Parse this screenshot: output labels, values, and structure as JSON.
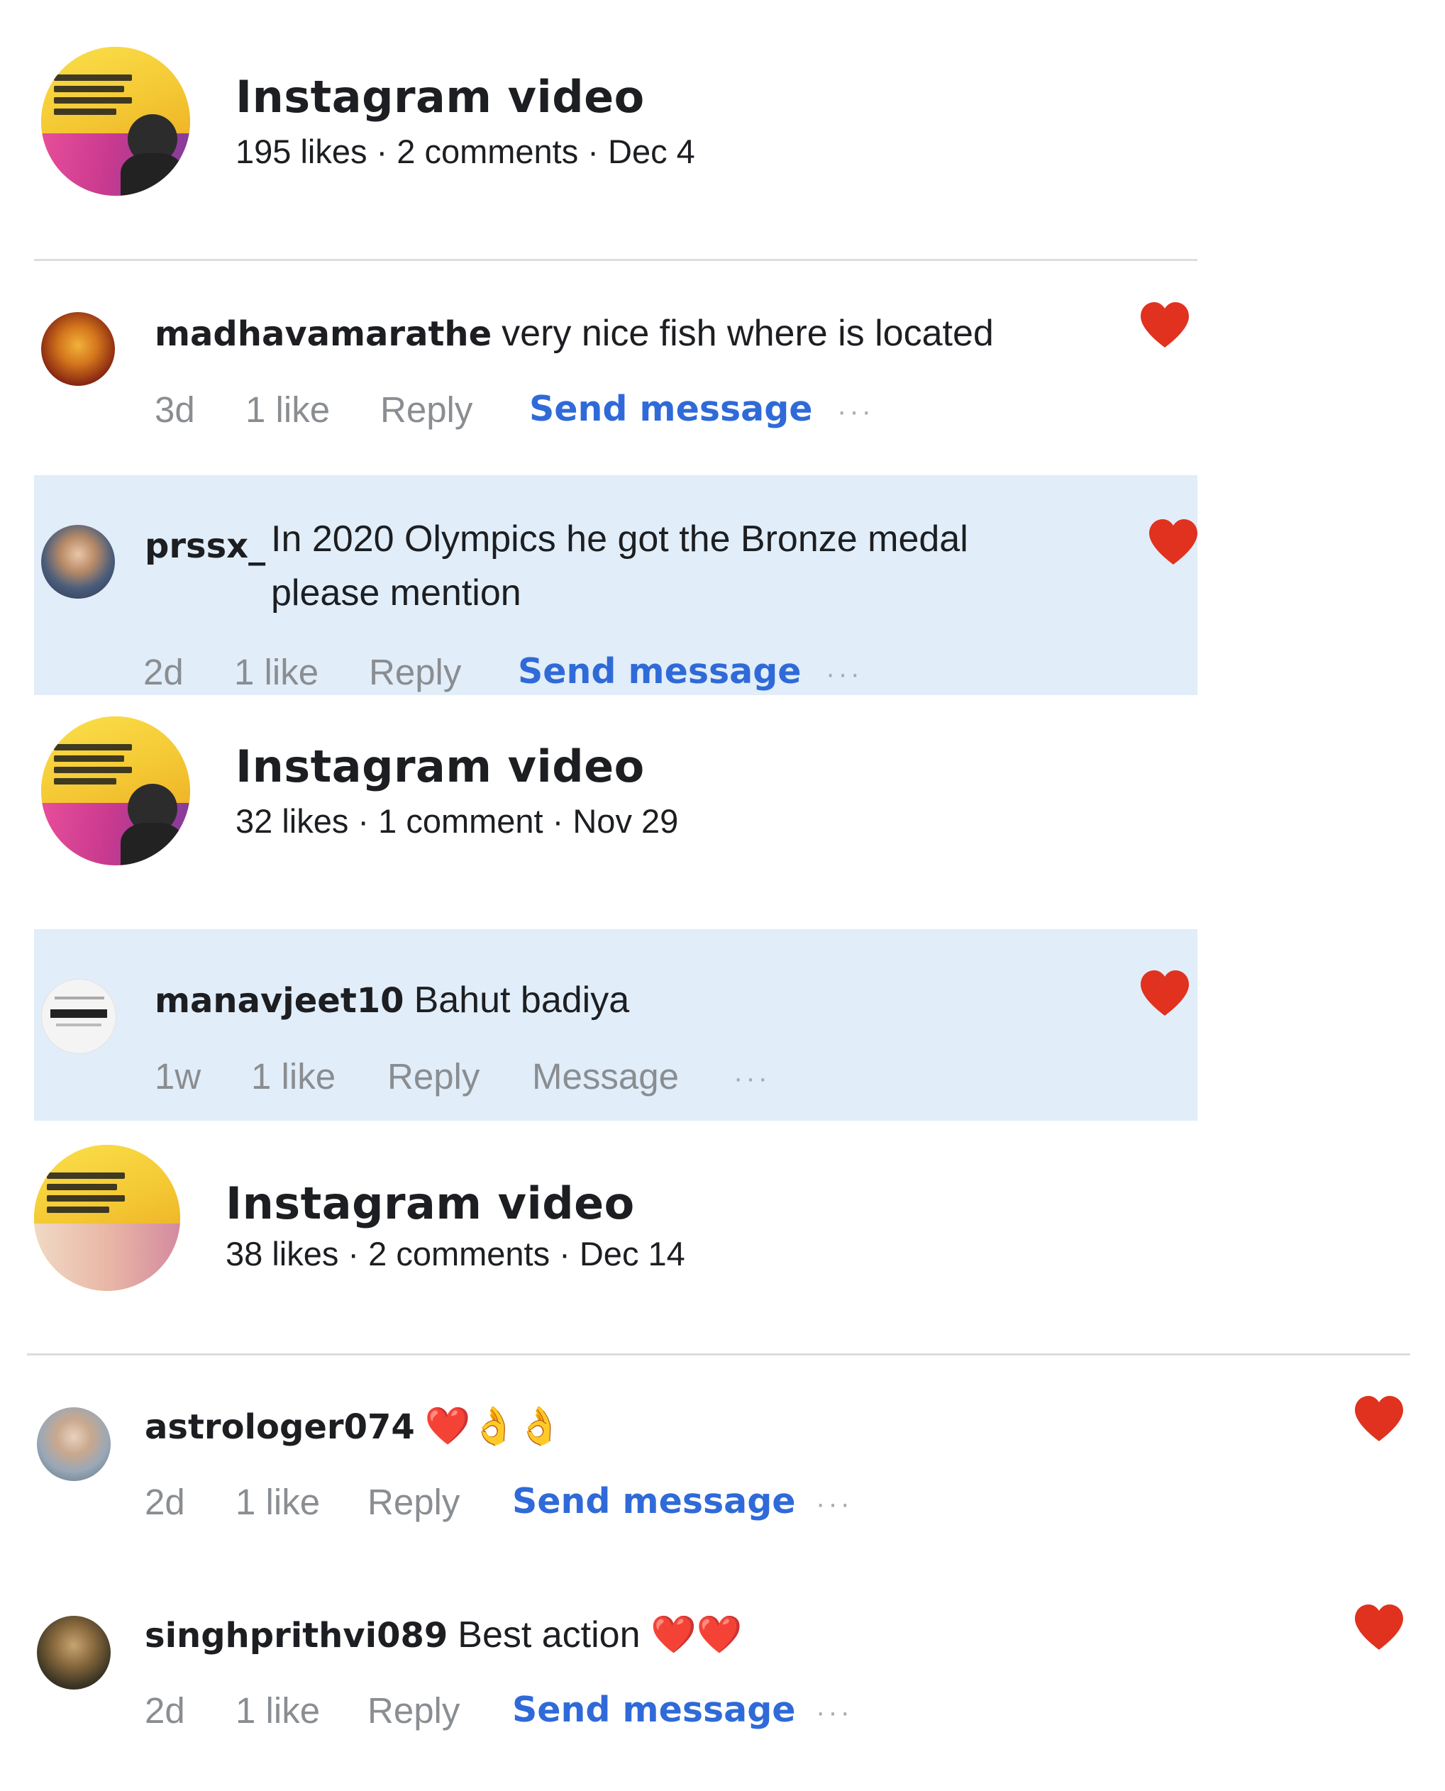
{
  "posts": [
    {
      "title": "Instagram video",
      "meta": "195 likes · 2 comments · Dec 4",
      "comments": [
        {
          "user": "madhavamarathe",
          "text": "very nice fish where is located",
          "time": "3d",
          "likes": "1 like",
          "reply": "Reply",
          "message": "Send message",
          "more": "···"
        },
        {
          "user": "prssx_",
          "text_line1": "In 2020 Olympics he got the Bronze medal",
          "text_line2": "please mention",
          "time": "2d",
          "likes": "1 like",
          "reply": "Reply",
          "message": "Send message",
          "more": "···"
        }
      ]
    },
    {
      "title": "Instagram video",
      "meta": "32 likes · 1 comment · Nov 29",
      "comments": [
        {
          "user": "manavjeet10",
          "text": "Bahut badiya",
          "time": "1w",
          "likes": "1 like",
          "reply": "Reply",
          "message": "Message",
          "more": "···"
        }
      ]
    },
    {
      "title": "Instagram video",
      "meta": "38 likes · 2 comments · Dec 14",
      "comments": [
        {
          "user": "astrologer074",
          "text": "❤️👌👌",
          "time": "2d",
          "likes": "1 like",
          "reply": "Reply",
          "message": "Send message",
          "more": "···"
        },
        {
          "user": "singhprithvi089",
          "text": "Best action ❤️❤️",
          "time": "2d",
          "likes": "1 like",
          "reply": "Reply",
          "message": "Send message",
          "more": "···"
        }
      ]
    }
  ],
  "colors": {
    "heart": "#e0321f",
    "link": "#2f6ad8",
    "muted": "#8a8d91",
    "highlight": "#e1edf8"
  },
  "icons": {
    "liked": "heart-icon",
    "more": "more-options-icon"
  }
}
